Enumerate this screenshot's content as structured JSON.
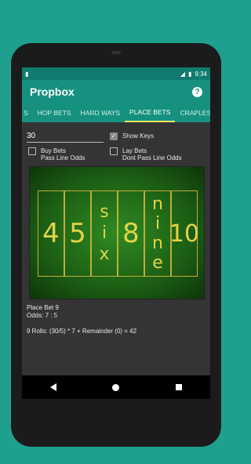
{
  "status": {
    "time": "9:34"
  },
  "appbar": {
    "title": "Propbox"
  },
  "tabs": [
    "S",
    "HOP BETS",
    "HARD WAYS",
    "PLACE BETS",
    "CRAPLESS"
  ],
  "form": {
    "number_value": "30",
    "show_keys_label": "Show Keys",
    "buy_bets_label": "Buy Bets",
    "pass_line_odds_label": "Pass Line Odds",
    "lay_bets_label": "Lay Bets",
    "dont_pass_line_odds_label": "Dont Pass Line Odds"
  },
  "table": {
    "numbers": [
      "4",
      "5",
      "six",
      "8",
      "nine",
      "10"
    ]
  },
  "info": {
    "line1": "Place Bet 9",
    "line2": "Odds: 7 : 5",
    "line3": "9 Rolls: (30/5) * 7 + Remainder (0) = 42"
  }
}
